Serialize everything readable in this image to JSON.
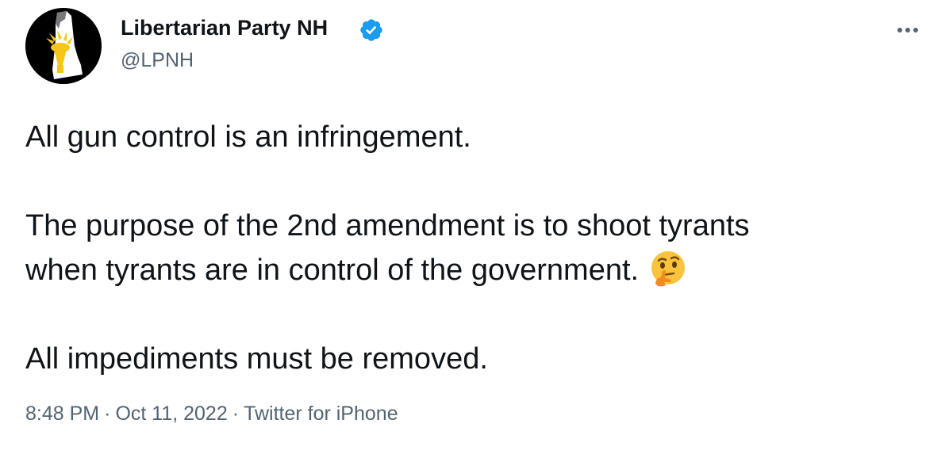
{
  "author": {
    "name": "Libertarian Party NH",
    "handle": "@LPNH",
    "verified_icon": "verified-badge-icon",
    "verified_color": "#1d9bf0",
    "avatar_icon": "torch-on-nh-map-logo"
  },
  "more_icon": "more-dots-icon",
  "tweet": {
    "line1": "All gun control is an infringement.",
    "line2": "The purpose of the 2nd amendment is to shoot tyrants",
    "line3": "when tyrants are in control of the government.",
    "line3_emoji": "thinking-face-icon",
    "line4": "All impediments must be removed."
  },
  "meta": {
    "time": "8:48 PM",
    "separator": "·",
    "date": "Oct 11, 2022",
    "source": "Twitter for iPhone"
  },
  "colors": {
    "text_primary": "#0f1419",
    "text_secondary": "#536471",
    "torch_gold": "#f5c518"
  }
}
